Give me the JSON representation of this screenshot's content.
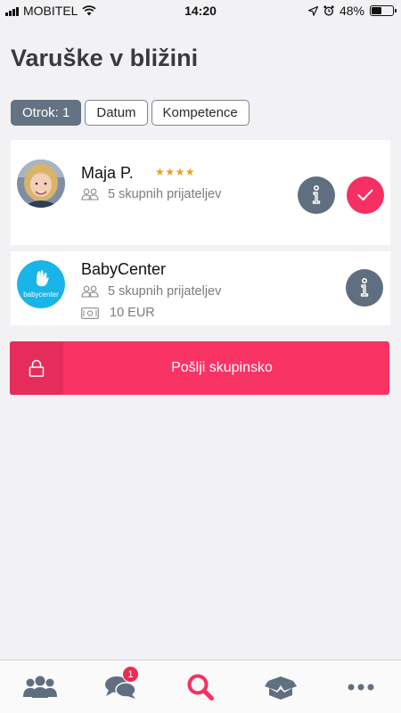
{
  "status_bar": {
    "carrier": "MOBITEL",
    "time": "14:20",
    "battery_text": "48%",
    "battery_level": 0.48
  },
  "page": {
    "title": "Varuške v bližini"
  },
  "filters": [
    {
      "label": "Otrok: 1",
      "active": true
    },
    {
      "label": "Datum",
      "active": false
    },
    {
      "label": "Kompetence",
      "active": false
    }
  ],
  "results": [
    {
      "name": "Maja P.",
      "rating": 4,
      "stars_text": "★★★★",
      "friends_text": "5 skupnih prijateljev",
      "avatar": "person-photo"
    },
    {
      "name": "BabyCenter",
      "friends_text": "5 skupnih prijateljev",
      "price_text": "10 EUR",
      "logo_text": "babycenter",
      "avatar": "babycenter-logo"
    }
  ],
  "group_send": {
    "label": "Pošlji skupinsko"
  },
  "tab_bar": {
    "tabs": [
      {
        "name": "people",
        "icon": "people-icon"
      },
      {
        "name": "messages",
        "icon": "chat-icon",
        "badge": "1"
      },
      {
        "name": "search",
        "icon": "search-icon",
        "active": true
      },
      {
        "name": "boxes",
        "icon": "open-box-icon"
      },
      {
        "name": "more",
        "icon": "more-icon"
      }
    ]
  },
  "colors": {
    "accent": "#f72f62",
    "slate": "#5f6f7f",
    "star": "#e9a21b",
    "babycenter": "#19b4e8"
  }
}
